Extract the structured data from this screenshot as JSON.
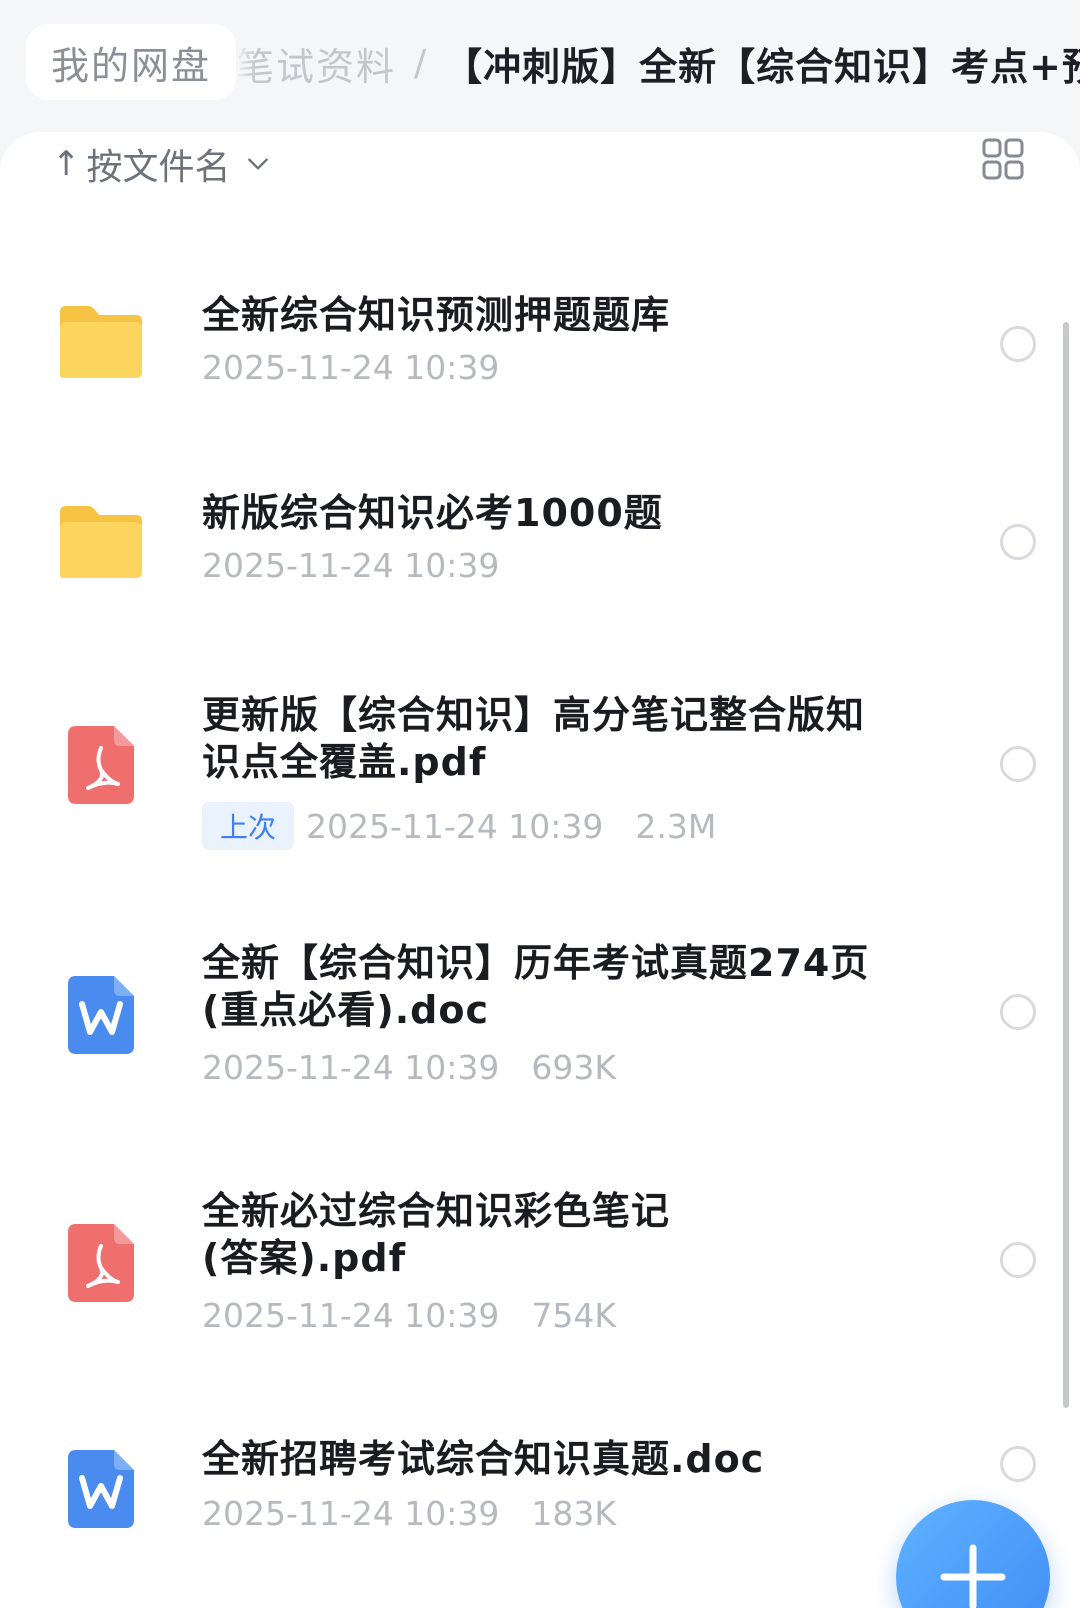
{
  "breadcrumb": {
    "home": "我的网盘",
    "parent": "笔试资料",
    "separator": "/",
    "current": "【冲刺版】全新【综合知识】考点+预测"
  },
  "toolbar": {
    "sort_arrow": "↑",
    "sort_label": "按文件名",
    "view_toggle_icon": "grid-view-icon"
  },
  "files": [
    {
      "type": "folder",
      "icon": "folder-icon",
      "name": "全新综合知识预测押题题库",
      "date": "2025-11-24 10:39",
      "size": ""
    },
    {
      "type": "folder",
      "icon": "folder-icon",
      "name": "新版综合知识必考1000题",
      "date": "2025-11-24 10:39",
      "size": ""
    },
    {
      "type": "pdf",
      "icon": "pdf-icon",
      "name_line1": "更新版【综合知识】高分笔记整合版知",
      "name_line2": "识点全覆盖.pdf",
      "badge": "上次",
      "date": "2025-11-24 10:39",
      "size": "2.3M"
    },
    {
      "type": "doc",
      "icon": "word-icon",
      "name_line1": "全新【综合知识】历年考试真题274页",
      "name_line2": "(重点必看).doc",
      "date": "2025-11-24 10:39",
      "size": "693K"
    },
    {
      "type": "pdf",
      "icon": "pdf-icon",
      "name_line1": "全新必过综合知识彩色笔记",
      "name_line2": "(答案).pdf",
      "date": "2025-11-24 10:39",
      "size": "754K"
    },
    {
      "type": "doc",
      "icon": "word-icon",
      "name": "全新招聘考试综合知识真题.doc",
      "date": "2025-11-24 10:39",
      "size": "183K"
    }
  ],
  "fab": {
    "icon": "plus-icon"
  },
  "colors": {
    "folder": "#f9cf4d",
    "pdf": "#ef6f6f",
    "word": "#4a8bf0",
    "accent": "#3f8cf6"
  }
}
